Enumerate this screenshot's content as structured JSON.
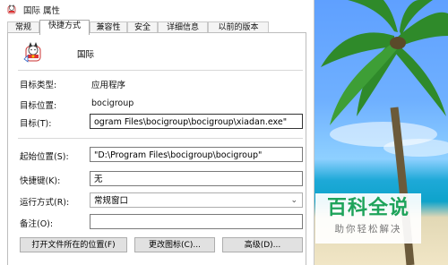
{
  "window": {
    "title": "国际 属性",
    "icon": "lucky-cat-icon"
  },
  "tabs": [
    {
      "label": "常规",
      "active": false
    },
    {
      "label": "快捷方式",
      "active": true
    },
    {
      "label": "兼容性",
      "active": false
    },
    {
      "label": "安全",
      "active": false
    },
    {
      "label": "详细信息",
      "active": false
    },
    {
      "label": "以前的版本",
      "active": false
    }
  ],
  "shortcut": {
    "name": "国际",
    "icon": "lucky-cat-icon"
  },
  "fields": {
    "target_type": {
      "label": "目标类型:",
      "value": "应用程序"
    },
    "target_location": {
      "label": "目标位置:",
      "value": "bocigroup"
    },
    "target": {
      "label": "目标(T):",
      "value": "ogram Files\\bocigroup\\bocigroup\\xiadan.exe\""
    },
    "start_in": {
      "label": "起始位置(S):",
      "value": "\"D:\\Program Files\\bocigroup\\bocigroup\""
    },
    "shortcut_key": {
      "label": "快捷键(K):",
      "value": "无"
    },
    "run": {
      "label": "运行方式(R):",
      "value": "常规窗口"
    },
    "comment": {
      "label": "备注(O):",
      "value": ""
    }
  },
  "buttons": {
    "open_location": "打开文件所在的位置(F)",
    "change_icon": "更改图标(C)...",
    "advanced": "高级(D)..."
  },
  "watermark": {
    "title": "百科全说",
    "subtitle": "助你轻松解决"
  },
  "colors": {
    "watermark_green": "#1ea35a",
    "sky": "#6fb0ff",
    "sea": "#0ea3cb"
  }
}
